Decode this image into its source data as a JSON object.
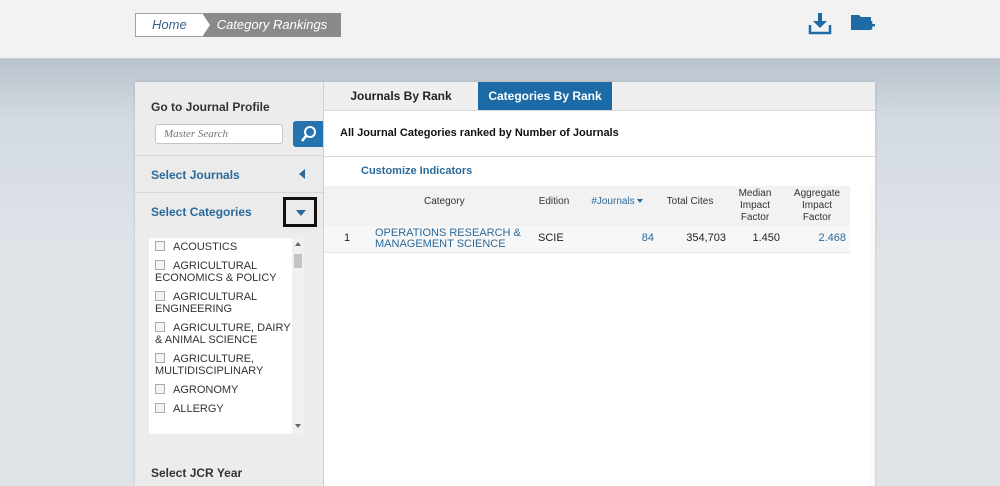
{
  "breadcrumb": {
    "home": "Home",
    "current": "Category Rankings"
  },
  "toolbar": {
    "download_icon": "download-icon",
    "add_folder_icon": "folder-add-icon"
  },
  "sidebar": {
    "journal_profile_title": "Go to Journal Profile",
    "search_placeholder": "Master Search",
    "select_journals": "Select Journals",
    "select_categories": "Select Categories",
    "categories": [
      "ACOUSTICS",
      "AGRICULTURAL ECONOMICS & POLICY",
      "AGRICULTURAL ENGINEERING",
      "AGRICULTURE, DAIRY & ANIMAL SCIENCE",
      "AGRICULTURE, MULTIDISCIPLINARY",
      "AGRONOMY",
      "ALLERGY"
    ],
    "select_jcr_year": "Select JCR Year"
  },
  "tabs": [
    {
      "label": "Journals By Rank",
      "active": false
    },
    {
      "label": "Categories By Rank",
      "active": true
    }
  ],
  "main": {
    "title": "All Journal Categories ranked by Number of Journals",
    "customize": "Customize Indicators"
  },
  "table": {
    "headers": {
      "category": "Category",
      "edition": "Edition",
      "journals": "#Journals",
      "total_cites": "Total Cites",
      "median_if": [
        "Median",
        "Impact",
        "Factor"
      ],
      "aggregate_if": [
        "Aggregate",
        "Impact",
        "Factor"
      ]
    },
    "rows": [
      {
        "rank": "1",
        "category": [
          "OPERATIONS RESEARCH &",
          "MANAGEMENT SCIENCE"
        ],
        "edition": "SCIE",
        "journals": "84",
        "total_cites": "354,703",
        "median_if": "1.450",
        "aggregate_if": "2.468"
      }
    ]
  },
  "colors": {
    "accent": "#1c6aa6",
    "link": "#2b6a9a"
  }
}
